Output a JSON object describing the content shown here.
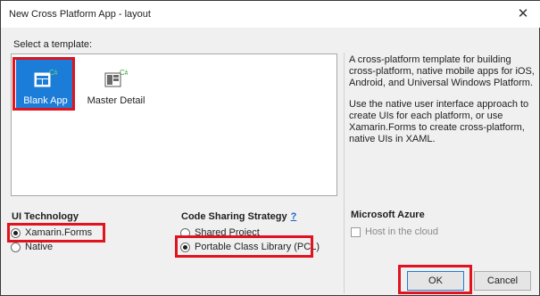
{
  "window": {
    "title": "New Cross Platform App - layout",
    "close_glyph": "✕"
  },
  "templates": {
    "heading": "Select a template:",
    "items": [
      {
        "label": "Blank App",
        "icon": "blank-app-icon",
        "selected": true
      },
      {
        "label": "Master Detail",
        "icon": "master-detail-icon",
        "selected": false
      }
    ]
  },
  "description": {
    "p1": "A cross-platform template for building cross-platform, native mobile apps for iOS, Android, and Universal Windows Platform.",
    "p2": "Use the native user interface approach to create UIs for each platform, or use Xamarin.Forms to create cross-platform, native UIs in XAML."
  },
  "ui_technology": {
    "title": "UI Technology",
    "options": [
      {
        "label": "Xamarin.Forms",
        "selected": true
      },
      {
        "label": "Native",
        "selected": false
      }
    ]
  },
  "code_sharing": {
    "title": "Code Sharing Strategy",
    "help": "?",
    "options": [
      {
        "label": "Shared Project",
        "selected": false
      },
      {
        "label": "Portable Class Library (PCL)",
        "selected": true
      }
    ]
  },
  "azure": {
    "title": "Microsoft Azure",
    "host_label": "Host in the cloud",
    "host_checked": false
  },
  "buttons": {
    "ok": "OK",
    "cancel": "Cancel"
  },
  "colors": {
    "accent": "#1c7dd8",
    "highlight": "#e0131f"
  }
}
